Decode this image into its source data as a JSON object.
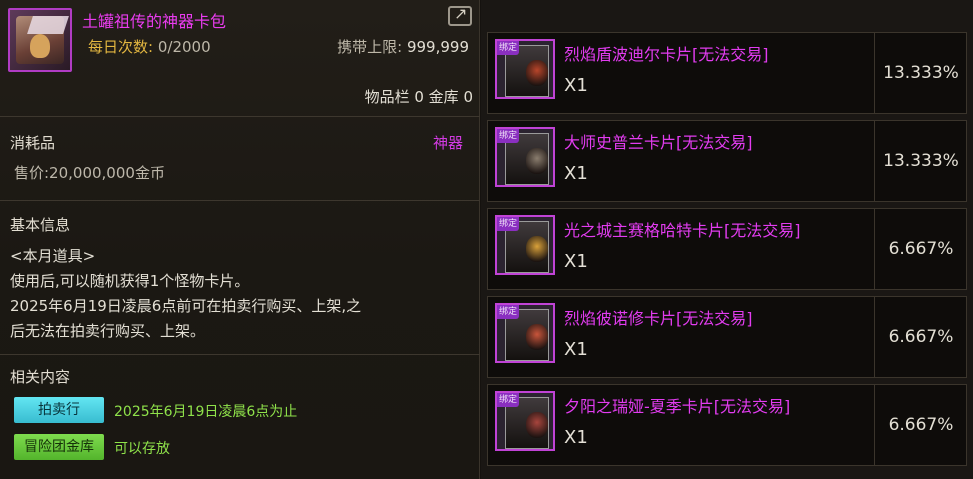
{
  "item": {
    "name": "土罐祖传的神器卡包",
    "daily_label": "每日次数:",
    "daily_value": "0/2000",
    "carry_label": "携带上限:",
    "carry_value": "999,999",
    "inventory": "物品栏 0 金库 0",
    "type": "消耗品",
    "category": "神器",
    "price": "售价:20,000,000金币",
    "basic_title": "基本信息",
    "desc_lines": [
      "<本月道具>",
      "使用后,可以随机获得1个怪物卡片。",
      "2025年6月19日凌晨6点前可在拍卖行购买、上架,之",
      "后无法在拍卖行购买、上架。"
    ],
    "related_title": "相关内容",
    "tags": [
      {
        "label": "拍卖行",
        "text": "2025年6月19日凌晨6点为止"
      },
      {
        "label": "冒险团金库",
        "text": "可以存放"
      }
    ]
  },
  "badge_label": "绑定",
  "cards": [
    {
      "name": "烈焰盾波迪尔卡片[无法交易]",
      "qty": "X1",
      "pct": "13.333%",
      "color": "#b8452a"
    },
    {
      "name": "大师史普兰卡片[无法交易]",
      "qty": "X1",
      "pct": "13.333%",
      "color": "#8a7d6e"
    },
    {
      "name": "光之城主赛格哈特卡片[无法交易]",
      "qty": "X1",
      "pct": "6.667%",
      "color": "#d9a13a"
    },
    {
      "name": "烈焰彼诺修卡片[无法交易]",
      "qty": "X1",
      "pct": "6.667%",
      "color": "#c9553b"
    },
    {
      "name": "夕阳之瑞娅-夏季卡片[无法交易]",
      "qty": "X1",
      "pct": "6.667%",
      "color": "#a8453d"
    }
  ]
}
